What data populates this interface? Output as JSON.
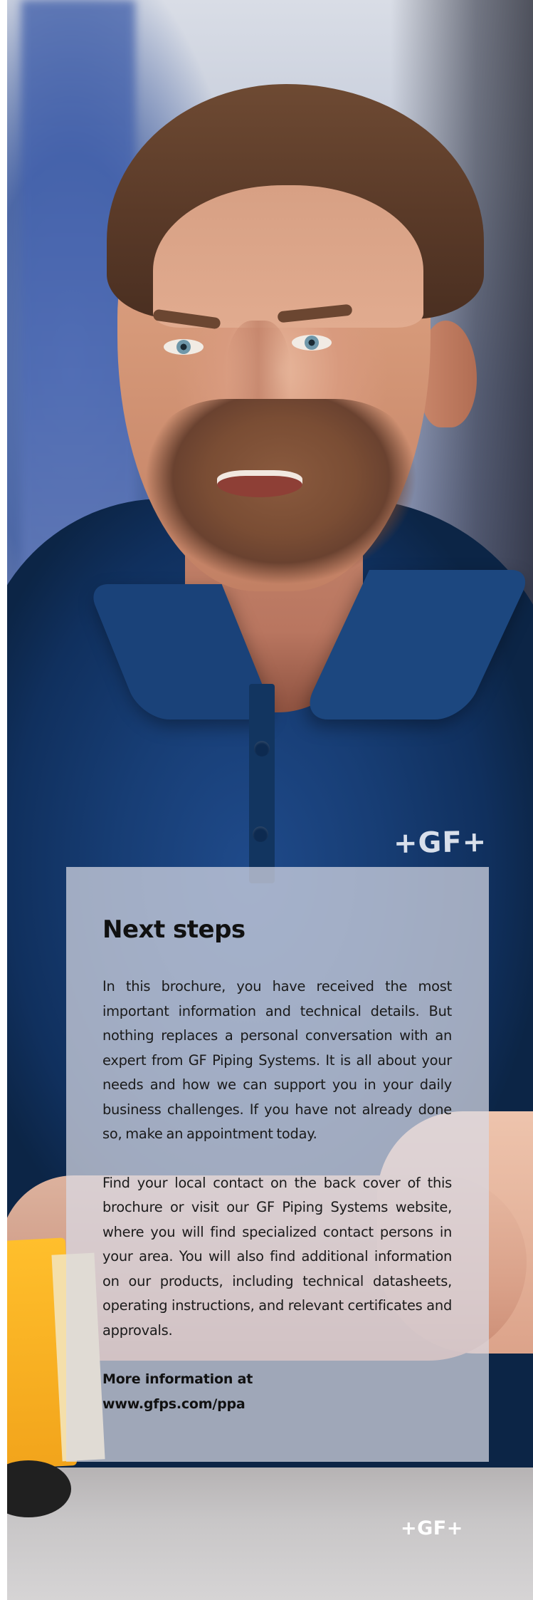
{
  "photo": {
    "alt": "Man in a navy GF+ polo shirt talking",
    "shirt_logo": "+GF+"
  },
  "panel": {
    "title": "Next steps",
    "paragraph_1": "In this brochure, you have received the most important information and technical details. But nothing replaces a personal conversation with an expert from GF Piping Systems. It is all about your needs and how we can support you in your daily business challenges. If you have not already done so, make an appointment today.",
    "paragraph_2": "Find your local contact on the back cover of this brochure or visit our GF Piping Systems website, where you will find specialized contact persons in your area. You will also find additional information on our products, including technical datasheets, operating instructions, and relevant certificates and approvals.",
    "more_info_label": "More information at",
    "more_info_link": "www.gfps.com/ppa"
  },
  "footer": {
    "logo": "+GF+"
  },
  "colors": {
    "shirt": "#173d74",
    "panel_overlay": "#d8d9e4",
    "text": "#111111",
    "logo": "#ffffff"
  }
}
